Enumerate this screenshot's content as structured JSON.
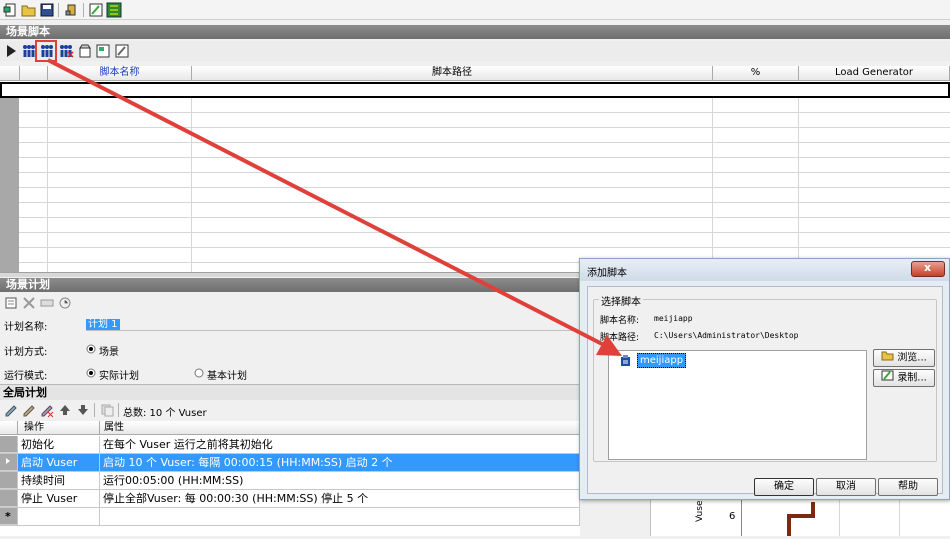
{
  "colors": {
    "selection": "#3399ff",
    "arrow": "#e0403a",
    "dialog_border": "#8aa5c8"
  },
  "scenario_scripts": {
    "title": "场景脚本",
    "columns": {
      "script_name": "脚本名称",
      "script_path": "脚本路径",
      "percent": "%",
      "load_generator": "Load Generator"
    }
  },
  "scenario_schedule": {
    "title": "场景计划",
    "schedule_name_label": "计划名称:",
    "schedule_name_value": "计划 1",
    "schedule_by_label": "计划方式:",
    "schedule_by_option": "场景",
    "run_mode_label": "运行模式:",
    "run_mode_real": "实际计划",
    "run_mode_basic": "基本计划"
  },
  "global_schedule": {
    "title": "全局计划",
    "total_label": "总数: 10 个 Vuser",
    "col_action": "操作",
    "col_properties": "属性",
    "rows": [
      {
        "action": "初始化",
        "properties": "在每个 Vuser 运行之前将其初始化"
      },
      {
        "action": "启动 Vuser",
        "properties": "启动 10 个 Vuser: 每隔 00:00:15 (HH:MM:SS) 启动 2 个"
      },
      {
        "action": "持续时间",
        "properties": "运行00:05:00 (HH:MM:SS)"
      },
      {
        "action": "停止 Vuser",
        "properties": "停止全部Vuser: 每 00:00:30 (HH:MM:SS) 停止 5 个"
      }
    ],
    "new_row_marker": "*"
  },
  "graph": {
    "ylabel": "Vusers",
    "tick": "6"
  },
  "dialog": {
    "title": "添加脚本",
    "close_glyph": "x",
    "group_label": "选择脚本",
    "name_label": "脚本名称:",
    "name_value": "meijiapp",
    "path_label": "脚本路径:",
    "path_value": "C:\\Users\\Administrator\\Desktop",
    "list_item": "meijiapp",
    "browse_button": "浏览...",
    "record_button": "录制...",
    "ok_button": "确定",
    "cancel_button": "取消",
    "help_button": "帮助"
  }
}
